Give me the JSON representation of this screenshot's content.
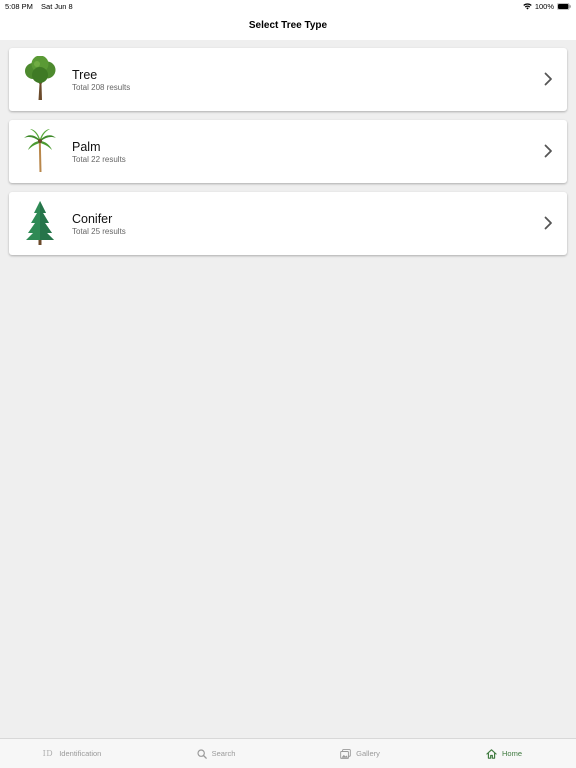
{
  "status_bar": {
    "time": "5:08 PM",
    "date": "Sat Jun 8",
    "battery": "100%"
  },
  "nav": {
    "title": "Select Tree Type"
  },
  "items": [
    {
      "title": "Tree",
      "subtitle": "Total 208 results",
      "icon": "deciduous-tree-icon"
    },
    {
      "title": "Palm",
      "subtitle": "Total 22 results",
      "icon": "palm-tree-icon"
    },
    {
      "title": "Conifer",
      "subtitle": "Total 25 results",
      "icon": "conifer-tree-icon"
    }
  ],
  "tabs": [
    {
      "label": "Identification",
      "glyph": "ID",
      "icon": "id-icon",
      "active": false
    },
    {
      "label": "Search",
      "icon": "search-icon",
      "active": false
    },
    {
      "label": "Gallery",
      "icon": "gallery-icon",
      "active": false
    },
    {
      "label": "Home",
      "icon": "home-icon",
      "active": true
    }
  ],
  "colors": {
    "background": "#efefef",
    "active_tab": "#3f7a3f",
    "inactive_tab": "#9a9a9a"
  }
}
